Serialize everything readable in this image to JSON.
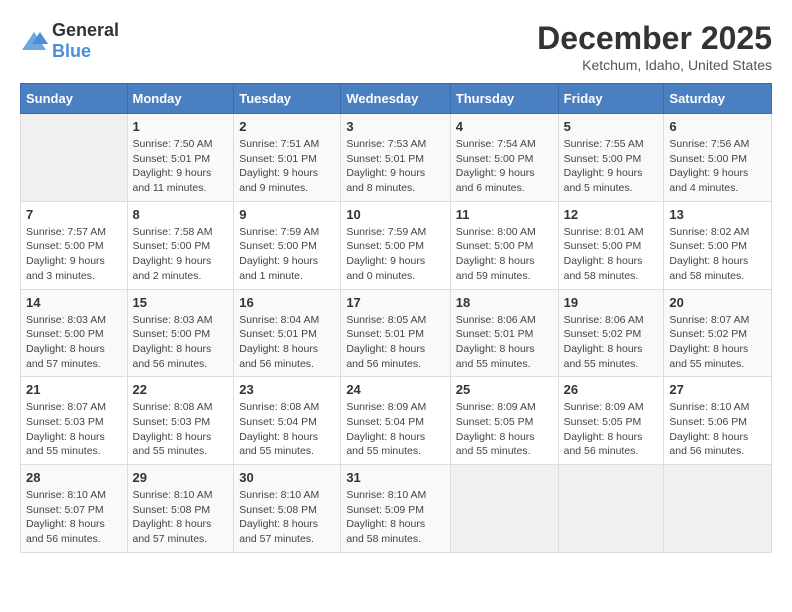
{
  "header": {
    "logo_general": "General",
    "logo_blue": "Blue",
    "title": "December 2025",
    "subtitle": "Ketchum, Idaho, United States"
  },
  "calendar": {
    "days_of_week": [
      "Sunday",
      "Monday",
      "Tuesday",
      "Wednesday",
      "Thursday",
      "Friday",
      "Saturday"
    ],
    "weeks": [
      [
        {
          "day": "",
          "info": ""
        },
        {
          "day": "1",
          "info": "Sunrise: 7:50 AM\nSunset: 5:01 PM\nDaylight: 9 hours\nand 11 minutes."
        },
        {
          "day": "2",
          "info": "Sunrise: 7:51 AM\nSunset: 5:01 PM\nDaylight: 9 hours\nand 9 minutes."
        },
        {
          "day": "3",
          "info": "Sunrise: 7:53 AM\nSunset: 5:01 PM\nDaylight: 9 hours\nand 8 minutes."
        },
        {
          "day": "4",
          "info": "Sunrise: 7:54 AM\nSunset: 5:00 PM\nDaylight: 9 hours\nand 6 minutes."
        },
        {
          "day": "5",
          "info": "Sunrise: 7:55 AM\nSunset: 5:00 PM\nDaylight: 9 hours\nand 5 minutes."
        },
        {
          "day": "6",
          "info": "Sunrise: 7:56 AM\nSunset: 5:00 PM\nDaylight: 9 hours\nand 4 minutes."
        }
      ],
      [
        {
          "day": "7",
          "info": "Sunrise: 7:57 AM\nSunset: 5:00 PM\nDaylight: 9 hours\nand 3 minutes."
        },
        {
          "day": "8",
          "info": "Sunrise: 7:58 AM\nSunset: 5:00 PM\nDaylight: 9 hours\nand 2 minutes."
        },
        {
          "day": "9",
          "info": "Sunrise: 7:59 AM\nSunset: 5:00 PM\nDaylight: 9 hours\nand 1 minute."
        },
        {
          "day": "10",
          "info": "Sunrise: 7:59 AM\nSunset: 5:00 PM\nDaylight: 9 hours\nand 0 minutes."
        },
        {
          "day": "11",
          "info": "Sunrise: 8:00 AM\nSunset: 5:00 PM\nDaylight: 8 hours\nand 59 minutes."
        },
        {
          "day": "12",
          "info": "Sunrise: 8:01 AM\nSunset: 5:00 PM\nDaylight: 8 hours\nand 58 minutes."
        },
        {
          "day": "13",
          "info": "Sunrise: 8:02 AM\nSunset: 5:00 PM\nDaylight: 8 hours\nand 58 minutes."
        }
      ],
      [
        {
          "day": "14",
          "info": "Sunrise: 8:03 AM\nSunset: 5:00 PM\nDaylight: 8 hours\nand 57 minutes."
        },
        {
          "day": "15",
          "info": "Sunrise: 8:03 AM\nSunset: 5:00 PM\nDaylight: 8 hours\nand 56 minutes."
        },
        {
          "day": "16",
          "info": "Sunrise: 8:04 AM\nSunset: 5:01 PM\nDaylight: 8 hours\nand 56 minutes."
        },
        {
          "day": "17",
          "info": "Sunrise: 8:05 AM\nSunset: 5:01 PM\nDaylight: 8 hours\nand 56 minutes."
        },
        {
          "day": "18",
          "info": "Sunrise: 8:06 AM\nSunset: 5:01 PM\nDaylight: 8 hours\nand 55 minutes."
        },
        {
          "day": "19",
          "info": "Sunrise: 8:06 AM\nSunset: 5:02 PM\nDaylight: 8 hours\nand 55 minutes."
        },
        {
          "day": "20",
          "info": "Sunrise: 8:07 AM\nSunset: 5:02 PM\nDaylight: 8 hours\nand 55 minutes."
        }
      ],
      [
        {
          "day": "21",
          "info": "Sunrise: 8:07 AM\nSunset: 5:03 PM\nDaylight: 8 hours\nand 55 minutes."
        },
        {
          "day": "22",
          "info": "Sunrise: 8:08 AM\nSunset: 5:03 PM\nDaylight: 8 hours\nand 55 minutes."
        },
        {
          "day": "23",
          "info": "Sunrise: 8:08 AM\nSunset: 5:04 PM\nDaylight: 8 hours\nand 55 minutes."
        },
        {
          "day": "24",
          "info": "Sunrise: 8:09 AM\nSunset: 5:04 PM\nDaylight: 8 hours\nand 55 minutes."
        },
        {
          "day": "25",
          "info": "Sunrise: 8:09 AM\nSunset: 5:05 PM\nDaylight: 8 hours\nand 55 minutes."
        },
        {
          "day": "26",
          "info": "Sunrise: 8:09 AM\nSunset: 5:05 PM\nDaylight: 8 hours\nand 56 minutes."
        },
        {
          "day": "27",
          "info": "Sunrise: 8:10 AM\nSunset: 5:06 PM\nDaylight: 8 hours\nand 56 minutes."
        }
      ],
      [
        {
          "day": "28",
          "info": "Sunrise: 8:10 AM\nSunset: 5:07 PM\nDaylight: 8 hours\nand 56 minutes."
        },
        {
          "day": "29",
          "info": "Sunrise: 8:10 AM\nSunset: 5:08 PM\nDaylight: 8 hours\nand 57 minutes."
        },
        {
          "day": "30",
          "info": "Sunrise: 8:10 AM\nSunset: 5:08 PM\nDaylight: 8 hours\nand 57 minutes."
        },
        {
          "day": "31",
          "info": "Sunrise: 8:10 AM\nSunset: 5:09 PM\nDaylight: 8 hours\nand 58 minutes."
        },
        {
          "day": "",
          "info": ""
        },
        {
          "day": "",
          "info": ""
        },
        {
          "day": "",
          "info": ""
        }
      ]
    ]
  }
}
